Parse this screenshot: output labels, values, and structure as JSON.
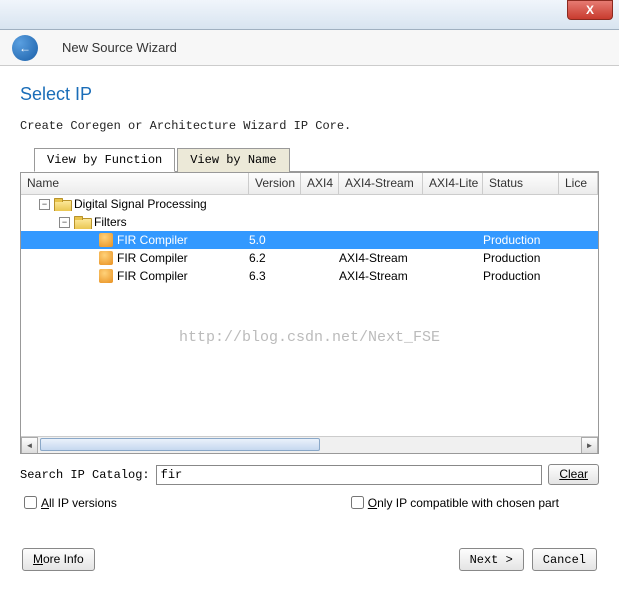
{
  "titlebar": {
    "close": "X"
  },
  "header": {
    "title": "New Source Wizard"
  },
  "page": {
    "heading": "Select IP",
    "subtitle": "Create Coregen or Architecture Wizard IP Core."
  },
  "tabs": {
    "byFunction": "View by Function",
    "byName": "View by Name"
  },
  "columns": {
    "name": "Name",
    "version": "Version",
    "axi4": "AXI4",
    "axi4stream": "AXI4-Stream",
    "axi4lite": "AXI4-Lite",
    "status": "Status",
    "license": "Lice"
  },
  "tree": {
    "node0": {
      "label": "Digital Signal Processing"
    },
    "node1": {
      "label": "Filters"
    },
    "rows": [
      {
        "name": "FIR Compiler",
        "version": "5.0",
        "axi4": "",
        "axi4s": "",
        "axi4l": "",
        "status": "Production"
      },
      {
        "name": "FIR Compiler",
        "version": "6.2",
        "axi4": "",
        "axi4s": "AXI4-Stream",
        "axi4l": "",
        "status": "Production"
      },
      {
        "name": "FIR Compiler",
        "version": "6.3",
        "axi4": "",
        "axi4s": "AXI4-Stream",
        "axi4l": "",
        "status": "Production"
      }
    ]
  },
  "watermark": "http://blog.csdn.net/Next_FSE",
  "search": {
    "label": "Search IP Catalog:",
    "value": "fir",
    "clear": "Clear"
  },
  "checks": {
    "allVersionsPrefix": "A",
    "allVersionsRest": "ll IP versions",
    "onlyCompatPrefix": "O",
    "onlyCompatRest": "nly IP compatible with chosen part"
  },
  "buttons": {
    "moreInfoPrefix": "M",
    "moreInfoRest": "ore Info",
    "next": "Next >",
    "cancel": "Cancel"
  }
}
